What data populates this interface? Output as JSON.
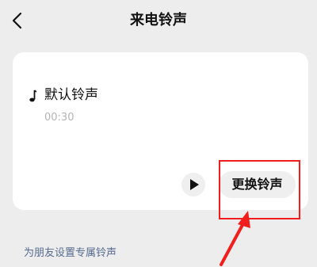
{
  "header": {
    "title": "来电铃声",
    "back_icon": "chevron-left-icon"
  },
  "ringtone": {
    "name": "默认铃声",
    "duration": "00:30",
    "icon": "music-note-icon",
    "play_icon": "play-icon",
    "change_label": "更换铃声"
  },
  "friend_link": "为朋友设置专属铃声",
  "annotation": {
    "color": "#f21d1d"
  }
}
